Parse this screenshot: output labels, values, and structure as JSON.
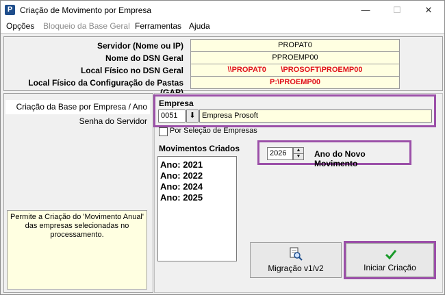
{
  "window": {
    "title": "Criação de Movimento por Empresa",
    "minimize": "—",
    "maximize": "☐",
    "close": "✕",
    "app_icon_letter": "P"
  },
  "menu": [
    {
      "label": "Opções",
      "enabled": true
    },
    {
      "label": "Bloqueio da Base Geral",
      "enabled": false
    },
    {
      "label": "Ferramentas",
      "enabled": true
    },
    {
      "label": "Ajuda",
      "enabled": true
    }
  ],
  "server_info": {
    "servidor_label": "Servidor (Nome ou IP)",
    "servidor_value": "PROPAT0",
    "dsn_label": "Nome do DSN Geral",
    "dsn_value": "PPROEMP00",
    "local_dsn_label": "Local Físico no DSN Geral",
    "local_dsn_value": "\\\\PROPAT0       \\PROSOFT\\PROEMP00",
    "local_gap_label": "Local Físico da Configuração de Pastas (GAP)",
    "local_gap_value": "P:\\PROEMP00"
  },
  "nav": {
    "items": [
      {
        "label": "Criação da Base por Empresa / Ano"
      },
      {
        "label": "Senha do Servidor"
      }
    ],
    "hint": "Permite a Criação do 'Movimento Anual' das empresas selecionadas no processamento."
  },
  "empresa": {
    "label": "Empresa",
    "code": "0051",
    "button_glyph": "⬇",
    "name": "Empresa Prosoft",
    "por_selecao_label": "Por Seleção de Empresas"
  },
  "movimentos": {
    "label": "Movimentos Criados",
    "items": [
      "Ano: 2021",
      "Ano: 2022",
      "Ano: 2024",
      "Ano: 2025"
    ]
  },
  "ano": {
    "value": "2026",
    "label": "Ano do Novo Movimento"
  },
  "buttons": {
    "migracao_label": "Migração v1/v2",
    "iniciar_label": "Iniciar Criação"
  },
  "colors": {
    "accent_outline": "#9b4fa8",
    "field_yellow": "#ffffe1",
    "path_red": "#e0101a",
    "check_green": "#1a9a2a"
  }
}
